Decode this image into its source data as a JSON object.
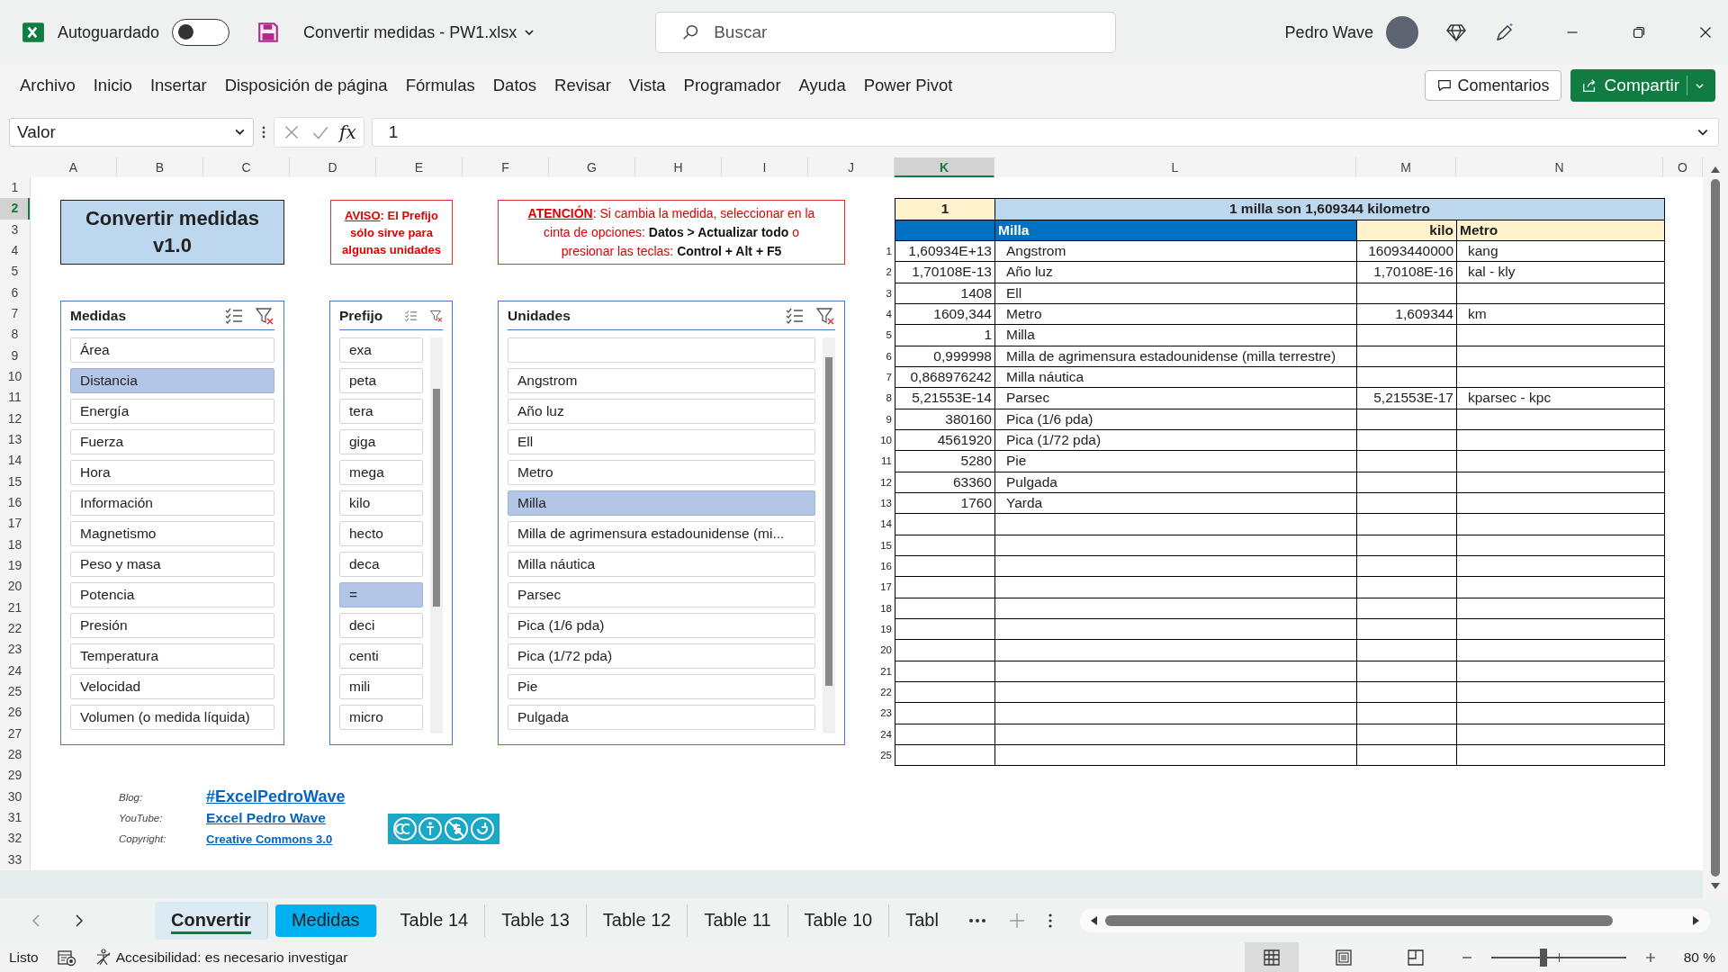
{
  "app": {
    "autosave_label": "Autoguardado",
    "autosave_on": false,
    "file_title": "Convertir medidas - PW1.xlsx",
    "search_placeholder": "Buscar",
    "user": "Pedro Wave"
  },
  "menu": [
    "Archivo",
    "Inicio",
    "Insertar",
    "Disposición de página",
    "Fórmulas",
    "Datos",
    "Revisar",
    "Vista",
    "Programador",
    "Ayuda",
    "Power Pivot"
  ],
  "actions": {
    "comments": "Comentarios",
    "share": "Compartir"
  },
  "formula_bar": {
    "name_box": "Valor",
    "function_label": "fx",
    "value": "1"
  },
  "columns": [
    {
      "label": "A",
      "selected": false
    },
    {
      "label": "B",
      "selected": false
    },
    {
      "label": "C",
      "selected": false
    },
    {
      "label": "D",
      "selected": false
    },
    {
      "label": "E",
      "selected": false
    },
    {
      "label": "F",
      "selected": false
    },
    {
      "label": "G",
      "selected": false
    },
    {
      "label": "H",
      "selected": false
    },
    {
      "label": "I",
      "selected": false
    },
    {
      "label": "J",
      "selected": false
    },
    {
      "label": "K",
      "selected": true
    },
    {
      "label": "L",
      "selected": false
    },
    {
      "label": "M",
      "selected": false
    },
    {
      "label": "N",
      "selected": false
    },
    {
      "label": "O",
      "selected": false
    }
  ],
  "row_numbers": [
    {
      "label": "1",
      "selected": false
    },
    {
      "label": "2",
      "selected": true
    },
    {
      "label": "3",
      "selected": false
    },
    {
      "label": "4",
      "selected": false
    },
    {
      "label": "5",
      "selected": false
    },
    {
      "label": "6",
      "selected": false
    },
    {
      "label": "7",
      "selected": false
    },
    {
      "label": "8",
      "selected": false
    },
    {
      "label": "9",
      "selected": false
    },
    {
      "label": "10",
      "selected": false
    },
    {
      "label": "11",
      "selected": false
    },
    {
      "label": "12",
      "selected": false
    },
    {
      "label": "13",
      "selected": false
    },
    {
      "label": "14",
      "selected": false
    },
    {
      "label": "15",
      "selected": false
    },
    {
      "label": "16",
      "selected": false
    },
    {
      "label": "17",
      "selected": false
    },
    {
      "label": "18",
      "selected": false
    },
    {
      "label": "19",
      "selected": false
    },
    {
      "label": "20",
      "selected": false
    },
    {
      "label": "21",
      "selected": false
    },
    {
      "label": "22",
      "selected": false
    },
    {
      "label": "23",
      "selected": false
    },
    {
      "label": "24",
      "selected": false
    },
    {
      "label": "25",
      "selected": false
    },
    {
      "label": "26",
      "selected": false
    },
    {
      "label": "27",
      "selected": false
    },
    {
      "label": "28",
      "selected": false
    },
    {
      "label": "29",
      "selected": false
    },
    {
      "label": "30",
      "selected": false
    },
    {
      "label": "31",
      "selected": false
    },
    {
      "label": "32",
      "selected": false
    },
    {
      "label": "33",
      "selected": false
    }
  ],
  "title_box": {
    "lines": [
      "Convertir medidas",
      "v1.0"
    ]
  },
  "notices": [
    {
      "kind": "warning",
      "heading": "AVISO",
      "text": ": El Prefijo sólo sirve para algunas unidades"
    },
    {
      "kind": "attention",
      "heading": "ATENCIÓN",
      "text": ": Si cambia la medida, seleccionar en la cinta de opciones: **Datos > Actualizar todo** o presionar las teclas: **Control + Alt + F5**"
    }
  ],
  "slicers": [
    {
      "title": "Medidas",
      "scrollbar": false,
      "items": [
        {
          "label": "Área",
          "selected": false
        },
        {
          "label": "Distancia",
          "selected": true
        },
        {
          "label": "Energía",
          "selected": false
        },
        {
          "label": "Fuerza",
          "selected": false
        },
        {
          "label": "Hora",
          "selected": false
        },
        {
          "label": "Información",
          "selected": false
        },
        {
          "label": "Magnetismo",
          "selected": false
        },
        {
          "label": "Peso y masa",
          "selected": false
        },
        {
          "label": "Potencia",
          "selected": false
        },
        {
          "label": "Presión",
          "selected": false
        },
        {
          "label": "Temperatura",
          "selected": false
        },
        {
          "label": "Velocidad",
          "selected": false
        },
        {
          "label": "Volumen (o medida líquida)",
          "selected": false
        }
      ]
    },
    {
      "title": "Prefijo",
      "scrollbar": true,
      "items": [
        {
          "label": "exa",
          "selected": false
        },
        {
          "label": "peta",
          "selected": false
        },
        {
          "label": "tera",
          "selected": false
        },
        {
          "label": "giga",
          "selected": false
        },
        {
          "label": "mega",
          "selected": false
        },
        {
          "label": "kilo",
          "selected": false
        },
        {
          "label": "hecto",
          "selected": false
        },
        {
          "label": "deca",
          "selected": false
        },
        {
          "label": "=",
          "selected": true
        },
        {
          "label": "deci",
          "selected": false
        },
        {
          "label": "centi",
          "selected": false
        },
        {
          "label": "mili",
          "selected": false
        },
        {
          "label": "micro",
          "selected": false
        }
      ]
    },
    {
      "title": "Unidades",
      "scrollbar": true,
      "items": [
        {
          "selected": false
        },
        {
          "label": "Angstrom",
          "selected": false
        },
        {
          "label": "Año luz",
          "selected": false
        },
        {
          "label": "Ell",
          "selected": false
        },
        {
          "label": "Metro",
          "selected": false
        },
        {
          "label": "Milla",
          "selected": true
        },
        {
          "label": "Milla de agrimensura estadounidense (mi...",
          "selected": false
        },
        {
          "label": "Milla náutica",
          "selected": false
        },
        {
          "label": "Parsec",
          "selected": false
        },
        {
          "label": "Pica (1/6 pda)",
          "selected": false
        },
        {
          "label": "Pica (1/72 pda)",
          "selected": false
        },
        {
          "label": "Pie",
          "selected": false
        },
        {
          "label": "Pulgada",
          "selected": false
        }
      ]
    }
  ],
  "table": {
    "caption_value": "1",
    "caption": "1 milla son 1,609344 kilometro",
    "unit_header": "Milla",
    "prefix_header": "kilo",
    "symbol_header": "Metro",
    "rows": [
      {
        "n": "1",
        "value": "1,60934E+13",
        "unit": "Angstrom",
        "prefixed": "16093440000",
        "symbol": "kang"
      },
      {
        "n": "2",
        "value": "1,70108E-13",
        "unit": "Año luz",
        "prefixed": "1,70108E-16",
        "symbol": "kal - kly"
      },
      {
        "n": "3",
        "value": "1408",
        "unit": "Ell"
      },
      {
        "n": "4",
        "value": "1609,344",
        "unit": "Metro",
        "prefixed": "1,609344",
        "symbol": "km"
      },
      {
        "n": "5",
        "value": "1",
        "unit": "Milla"
      },
      {
        "n": "6",
        "value": "0,999998",
        "unit": "Milla de agrimensura estadounidense (milla terrestre)"
      },
      {
        "n": "7",
        "value": "0,868976242",
        "unit": "Milla náutica"
      },
      {
        "n": "8",
        "value": "5,21553E-14",
        "unit": "Parsec",
        "prefixed": "5,21553E-17",
        "symbol": "kparsec - kpc"
      },
      {
        "n": "9",
        "value": "380160",
        "unit": "Pica (1/6 pda)"
      },
      {
        "n": "10",
        "value": "4561920",
        "unit": "Pica (1/72 pda)"
      },
      {
        "n": "11",
        "value": "5280",
        "unit": "Pie"
      },
      {
        "n": "12",
        "value": "63360",
        "unit": "Pulgada"
      },
      {
        "n": "13",
        "value": "1760",
        "unit": "Yarda"
      },
      {
        "n": "14"
      },
      {
        "n": "15"
      },
      {
        "n": "16"
      },
      {
        "n": "17"
      },
      {
        "n": "18"
      },
      {
        "n": "19"
      },
      {
        "n": "20"
      },
      {
        "n": "21"
      },
      {
        "n": "22"
      },
      {
        "n": "23"
      },
      {
        "n": "24"
      },
      {
        "n": "25"
      }
    ]
  },
  "links": [
    {
      "kind": "large",
      "label": "Blog:",
      "link": "#ExcelPedroWave"
    },
    {
      "kind": "medium",
      "label": "YouTube:",
      "link": "Excel Pedro Wave"
    },
    {
      "kind": "small",
      "label": "Copyright:",
      "link": "Creative Commons 3.0"
    }
  ],
  "sheet_tabs": [
    {
      "label": "Convertir",
      "selected": true
    },
    {
      "label": "Medidas",
      "selected": false,
      "color": "#00b0f0"
    },
    {
      "label": "Table 14",
      "selected": false
    },
    {
      "label": "Table 13",
      "selected": false
    },
    {
      "label": "Table 12",
      "selected": false
    },
    {
      "label": "Table 11",
      "selected": false
    },
    {
      "label": "Table 10",
      "selected": false
    },
    {
      "label": "Tabl",
      "selected": false
    }
  ],
  "status": {
    "ready": "Listo",
    "accessibility": "Accesibilidad: es necesario investigar",
    "zoom": "80 %",
    "zoom_slider": {
      "level": 0.39
    },
    "view_modes": [
      {
        "kind": "normal",
        "selected": true
      },
      {
        "kind": "page_layout",
        "selected": false
      },
      {
        "kind": "page_break",
        "selected": false
      }
    ]
  }
}
